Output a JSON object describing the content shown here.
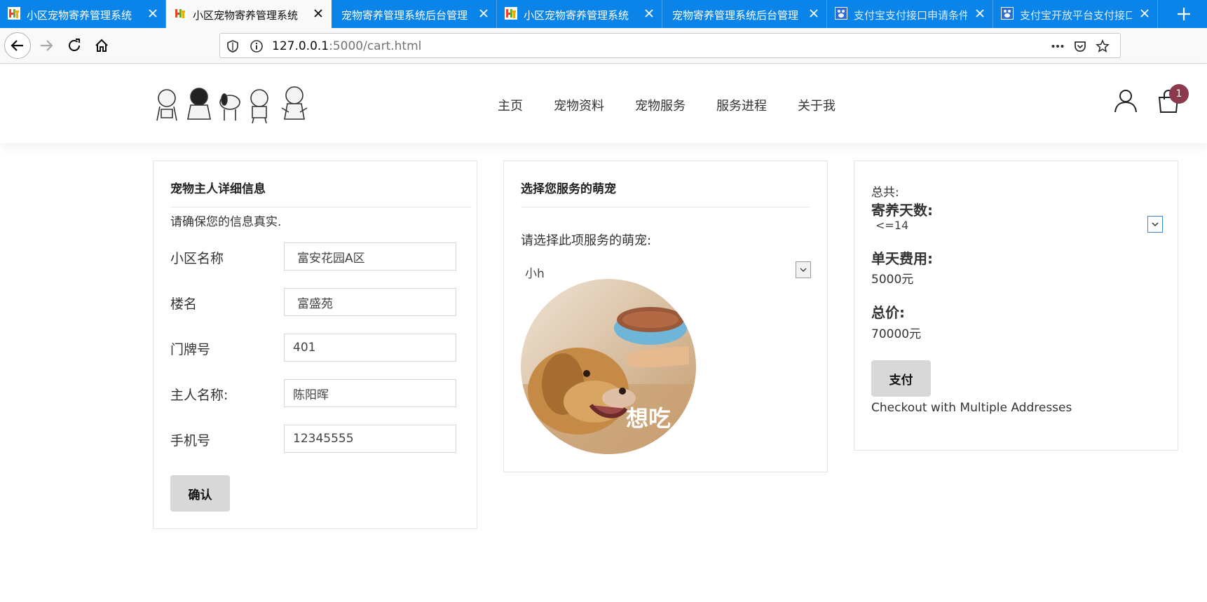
{
  "browser": {
    "tabs": [
      {
        "title": "小区宠物寄养管理系统",
        "favicon": "ht-logo-icon",
        "active": false
      },
      {
        "title": "小区宠物寄养管理系统",
        "favicon": "ht-logo-icon",
        "active": true
      },
      {
        "title": "宠物寄养管理系统后台管理",
        "favicon": "",
        "active": false
      },
      {
        "title": "小区宠物寄养管理系统",
        "favicon": "ht-logo-icon",
        "active": false
      },
      {
        "title": "宠物寄养管理系统后台管理",
        "favicon": "",
        "active": false
      },
      {
        "title": "支付宝支付接口申请条件",
        "favicon": "paw-icon",
        "active": false
      },
      {
        "title": "支付宝开放平台支付接口",
        "favicon": "paw-icon",
        "active": false
      }
    ],
    "url_host": "127.0.0.1",
    "url_path": ":5000/cart.html",
    "accent_color": "#0a84e8"
  },
  "site": {
    "nav": [
      "主页",
      "宠物资料",
      "宠物服务",
      "服务进程",
      "关于我"
    ],
    "cart_count": "1",
    "badge_color": "#8b3a4e"
  },
  "owner_form": {
    "title": "宠物主人详细信息",
    "subtitle": "请确保您的信息真实.",
    "fields": [
      {
        "label": "小区名称",
        "value": "富安花园A区"
      },
      {
        "label": "楼名",
        "value": "富盛苑"
      },
      {
        "label": "门牌号",
        "value": "401"
      },
      {
        "label": "主人名称:",
        "value": "陈阳晖"
      },
      {
        "label": "手机号",
        "value": "12345555"
      }
    ],
    "confirm_label": "确认"
  },
  "pet_select": {
    "title": "选择您服务的萌宠",
    "prompt": "请选择此项服务的萌宠:",
    "selected": "小h",
    "photo_caption": "想吃"
  },
  "summary": {
    "total_label": "总共:",
    "days_label": "寄养天数:",
    "days_selected": "<=14",
    "daily_fee_label": "单天费用:",
    "daily_fee": "5000元",
    "total_price_label": "总价:",
    "total_price": "70000元",
    "pay_label": "支付",
    "multi_address": "Checkout with Multiple Addresses"
  }
}
